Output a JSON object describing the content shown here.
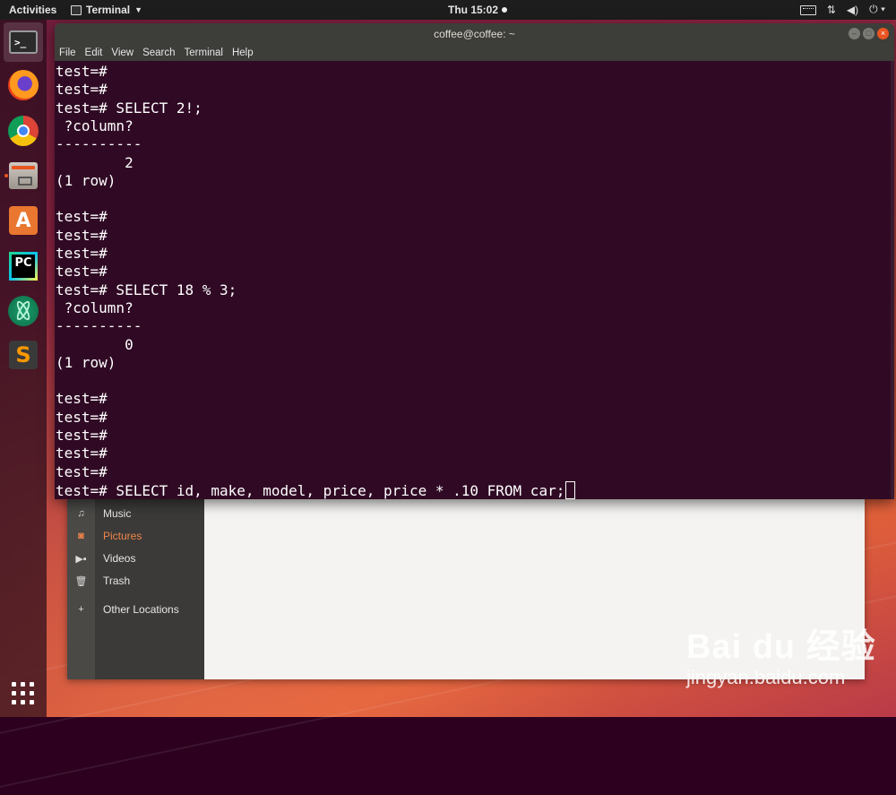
{
  "topbar": {
    "activities": "Activities",
    "app_menu": "Terminal",
    "clock": "Thu 15:02",
    "tray_icons": [
      "keyboard-icon",
      "network-icon",
      "volume-icon",
      "power-icon"
    ]
  },
  "dock": {
    "apps": [
      "terminal",
      "firefox",
      "chrome",
      "files",
      "ubuntu-software",
      "pycharm",
      "atom",
      "sublime-text",
      "show-applications"
    ]
  },
  "terminal": {
    "title": "coffee@coffee: ~",
    "menu": [
      "File",
      "Edit",
      "View",
      "Search",
      "Terminal",
      "Help"
    ],
    "lines": [
      "test=#",
      "test=#",
      "test=# SELECT 2!;",
      " ?column? ",
      "----------",
      "        2",
      "(1 row)",
      "",
      "test=#",
      "test=#",
      "test=#",
      "test=#",
      "test=# SELECT 18 % 3;",
      " ?column? ",
      "----------",
      "        0",
      "(1 row)",
      "",
      "test=#",
      "test=#",
      "test=#",
      "test=#",
      "test=#",
      "test=# SELECT id, make, model, price, price * .10 FROM car;"
    ]
  },
  "files": {
    "sidebar": [
      {
        "icon": "music-icon",
        "label": "Music"
      },
      {
        "icon": "camera-icon",
        "label": "Pictures",
        "selected": true
      },
      {
        "icon": "video-icon",
        "label": "Videos"
      },
      {
        "icon": "trash-icon",
        "label": "Trash"
      },
      {
        "icon": "plus-icon",
        "label": "Other Locations"
      }
    ]
  },
  "watermark": {
    "logo": "Bai du 经验",
    "url": "jingyan.baidu.com"
  },
  "colors": {
    "terminal_bg": "#300a24",
    "ubuntu_orange": "#e95420",
    "topbar": "#1d1d1d"
  }
}
